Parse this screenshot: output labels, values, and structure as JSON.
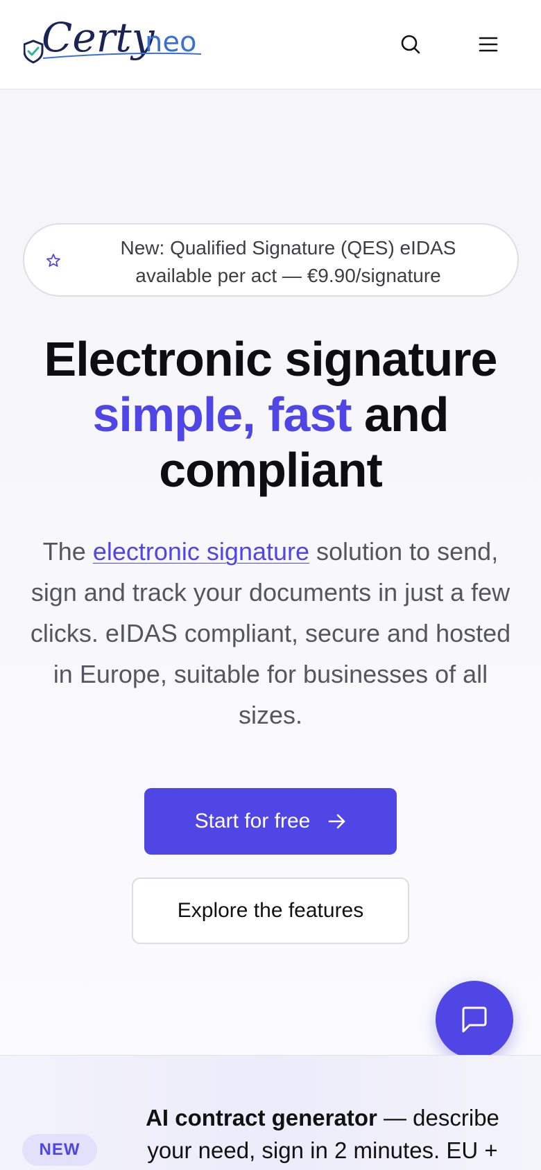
{
  "header": {
    "logo_text": "Certyneo",
    "search_icon": "search-icon",
    "menu_icon": "hamburger-menu-icon"
  },
  "hero": {
    "announcement_icon": "star-icon",
    "announcement": "New: Qualified Signature (QES) eIDAS available per act — €9.90/signature",
    "headline_line1": "Electronic signature",
    "headline_accent": "simple, fast",
    "headline_and": " and",
    "headline_line3": "compliant",
    "description_prefix": "The ",
    "description_link": "electronic signature",
    "description_suffix": " solution to send, sign and track your documents in just a few clicks. eIDAS compliant, secure and hosted in Europe, suitable for businesses of all sizes.",
    "primary_cta": "Start for free",
    "primary_cta_icon": "arrow-right-icon",
    "secondary_cta": "Explore the features"
  },
  "chat": {
    "icon": "chat-bubble-icon"
  },
  "banner": {
    "badge": "NEW",
    "title": "AI contract generator",
    "text": " — describe your need, sign in 2 minutes. EU +"
  },
  "colors": {
    "accent": "#4f46e5",
    "logo_navy": "#1a2456",
    "logo_blue": "#3a6fd8",
    "shield_green": "#2bb39b"
  }
}
